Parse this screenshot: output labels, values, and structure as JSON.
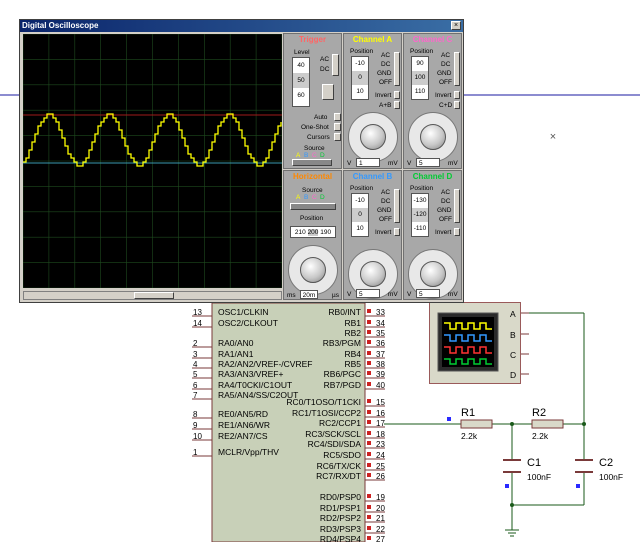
{
  "window": {
    "title": "Digital Oscilloscope",
    "close": "×"
  },
  "osc": {
    "trigger": {
      "title": "Trigger",
      "level_label": "Level",
      "level_values": [
        "40",
        "50",
        "60"
      ],
      "ac": "AC",
      "dc": "DC",
      "auto": "Auto",
      "one_shot": "One-Shot",
      "cursors": "Cursors",
      "source_label": "Source",
      "source_letters": [
        "A",
        "B",
        "C",
        "D"
      ]
    },
    "channel_a": {
      "title": "Channel A",
      "position_label": "Position",
      "position_values": [
        "-10",
        "0",
        "10"
      ],
      "coupling": [
        "AC",
        "DC",
        "GND",
        "OFF"
      ],
      "invert": "Invert",
      "mode": "A+B",
      "unit_v": "V",
      "unit_mv": "mV",
      "scale_value": "1"
    },
    "channel_c": {
      "title": "Channel C",
      "position_label": "Position",
      "position_values": [
        "90",
        "100",
        "110"
      ],
      "coupling": [
        "AC",
        "DC",
        "GND",
        "OFF"
      ],
      "invert": "Invert",
      "mode": "C+D",
      "unit_v": "V",
      "unit_mv": "mV",
      "scale_value": "5"
    },
    "horizontal": {
      "title": "Horizontal",
      "source_label": "Source",
      "source_letters": [
        "A",
        "B",
        "C",
        "D"
      ],
      "position_label": "Position",
      "position_values": [
        "210",
        "200",
        "190"
      ],
      "unit_ms": "ms",
      "unit_us": "µs",
      "scale_value": "20m"
    },
    "channel_b": {
      "title": "Channel B",
      "position_label": "Position",
      "position_values": [
        "-10",
        "0",
        "10"
      ],
      "coupling": [
        "AC",
        "DC",
        "GND",
        "OFF"
      ],
      "invert": "Invert",
      "unit_v": "V",
      "unit_mv": "mV",
      "scale_value": "5"
    },
    "channel_d": {
      "title": "Channel D",
      "position_label": "Position",
      "position_values": [
        "-130",
        "-120",
        "-110"
      ],
      "coupling": [
        "AC",
        "DC",
        "GND",
        "OFF"
      ],
      "invert": "Invert",
      "unit_v": "V",
      "unit_mv": "mV",
      "scale_value": "5"
    },
    "colors": {
      "trace_a": "#ffff00",
      "title_trigger": "#ff6666",
      "title_a": "#ffff00",
      "title_b": "#3399ff",
      "title_c": "#ff66cc",
      "title_d": "#00cc33",
      "title_horizontal": "#ff8800"
    }
  },
  "mcu": {
    "left_pins": [
      {
        "num": "13",
        "name": "OSC1/CLKIN"
      },
      {
        "num": "14",
        "name": "OSC2/CLKOUT"
      },
      {
        "num": "2",
        "name": "RA0/AN0"
      },
      {
        "num": "3",
        "name": "RA1/AN1"
      },
      {
        "num": "4",
        "name": "RA2/AN2/VREF-/CVREF"
      },
      {
        "num": "5",
        "name": "RA3/AN3/VREF+"
      },
      {
        "num": "6",
        "name": "RA4/T0CKI/C1OUT"
      },
      {
        "num": "7",
        "name": "RA5/AN4/SS/C2OUT"
      },
      {
        "num": "8",
        "name": "RE0/AN5/RD"
      },
      {
        "num": "9",
        "name": "RE1/AN6/WR"
      },
      {
        "num": "10",
        "name": "RE2/AN7/CS"
      },
      {
        "num": "1",
        "name": "MCLR/Vpp/THV"
      }
    ],
    "right_pins": [
      {
        "num": "33",
        "name": "RB0/INT"
      },
      {
        "num": "34",
        "name": "RB1"
      },
      {
        "num": "35",
        "name": "RB2"
      },
      {
        "num": "36",
        "name": "RB3/PGM"
      },
      {
        "num": "37",
        "name": "RB4"
      },
      {
        "num": "38",
        "name": "RB5"
      },
      {
        "num": "39",
        "name": "RB6/PGC"
      },
      {
        "num": "40",
        "name": "RB7/PGD"
      },
      {
        "num": "15",
        "name": "RC0/T1OSO/T1CKI"
      },
      {
        "num": "16",
        "name": "RC1/T1OSI/CCP2"
      },
      {
        "num": "17",
        "name": "RC2/CCP1"
      },
      {
        "num": "18",
        "name": "RC3/SCK/SCL"
      },
      {
        "num": "23",
        "name": "RC4/SDI/SDA"
      },
      {
        "num": "24",
        "name": "RC5/SDO"
      },
      {
        "num": "25",
        "name": "RC6/TX/CK"
      },
      {
        "num": "26",
        "name": "RC7/RX/DT"
      },
      {
        "num": "19",
        "name": "RD0/PSP0"
      },
      {
        "num": "20",
        "name": "RD1/PSP1"
      },
      {
        "num": "21",
        "name": "RD2/PSP2"
      },
      {
        "num": "22",
        "name": "RD3/PSP3"
      },
      {
        "num": "27",
        "name": "RD4/PSP4"
      }
    ]
  },
  "scope_symbol": {
    "inputs": [
      "A",
      "B",
      "C",
      "D"
    ]
  },
  "components": {
    "r1": {
      "ref": "R1",
      "value": "2.2k"
    },
    "r2": {
      "ref": "R2",
      "value": "2.2k"
    },
    "c1": {
      "ref": "C1",
      "value": "100nF"
    },
    "c2": {
      "ref": "C2",
      "value": "100nF"
    }
  }
}
